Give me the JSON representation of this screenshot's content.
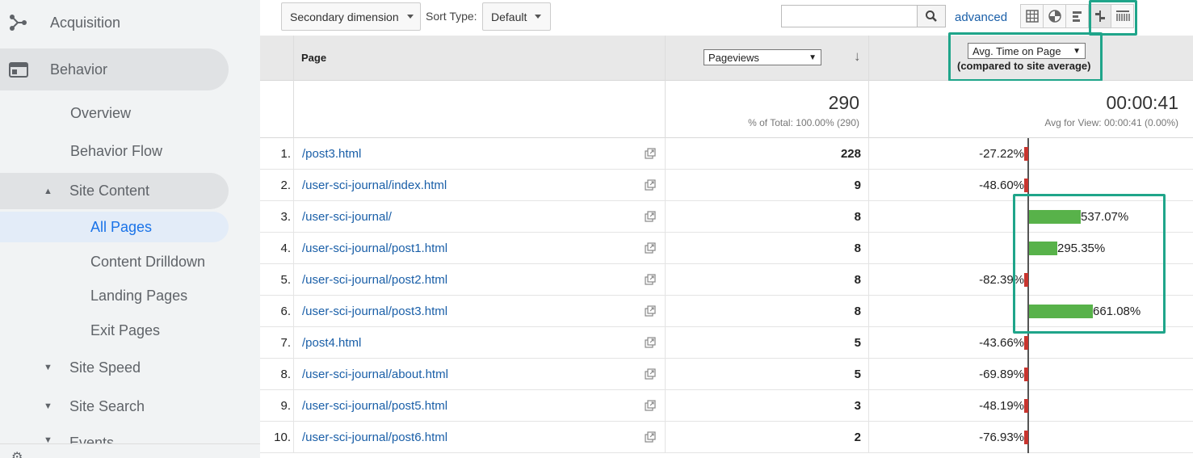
{
  "sidebar": {
    "acquisition": "Acquisition",
    "behavior": "Behavior",
    "overview": "Overview",
    "behavior_flow": "Behavior Flow",
    "site_content": "Site Content",
    "all_pages": "All Pages",
    "content_drilldown": "Content Drilldown",
    "landing_pages": "Landing Pages",
    "exit_pages": "Exit Pages",
    "site_speed": "Site Speed",
    "site_search": "Site Search",
    "events": "Events"
  },
  "toolbar": {
    "secondary_dimension": "Secondary dimension",
    "sort_type_label": "Sort Type:",
    "sort_type_value": "Default",
    "search_placeholder": "",
    "advanced": "advanced"
  },
  "table": {
    "page_header": "Page",
    "metric_select": "Pageviews",
    "compare_select": "Avg. Time on Page",
    "compare_sub": "(compared to site average)",
    "summary": {
      "pageviews": "290",
      "pageviews_sub": "% of Total: 100.00% (290)",
      "avg_time": "00:00:41",
      "avg_time_sub": "Avg for View: 00:00:41 (0.00%)"
    },
    "rows": [
      {
        "idx": "1.",
        "page": "/post3.html",
        "pv": "228",
        "pct": "-27.22%",
        "val": -27.22
      },
      {
        "idx": "2.",
        "page": "/user-sci-journal/index.html",
        "pv": "9",
        "pct": "-48.60%",
        "val": -48.6
      },
      {
        "idx": "3.",
        "page": "/user-sci-journal/",
        "pv": "8",
        "pct": "537.07%",
        "val": 537.07
      },
      {
        "idx": "4.",
        "page": "/user-sci-journal/post1.html",
        "pv": "8",
        "pct": "295.35%",
        "val": 295.35
      },
      {
        "idx": "5.",
        "page": "/user-sci-journal/post2.html",
        "pv": "8",
        "pct": "-82.39%",
        "val": -82.39
      },
      {
        "idx": "6.",
        "page": "/user-sci-journal/post3.html",
        "pv": "8",
        "pct": "661.08%",
        "val": 661.08
      },
      {
        "idx": "7.",
        "page": "/post4.html",
        "pv": "5",
        "pct": "-43.66%",
        "val": -43.66
      },
      {
        "idx": "8.",
        "page": "/user-sci-journal/about.html",
        "pv": "5",
        "pct": "-69.89%",
        "val": -69.89
      },
      {
        "idx": "9.",
        "page": "/user-sci-journal/post5.html",
        "pv": "3",
        "pct": "-48.19%",
        "val": -48.19
      },
      {
        "idx": "10.",
        "page": "/user-sci-journal/post6.html",
        "pv": "2",
        "pct": "-76.93%",
        "val": -76.93
      }
    ]
  },
  "colors": {
    "positive_bar": "#58b24a",
    "negative_bar": "#c8352f",
    "highlight": "#1fa58a",
    "link": "#1a5fa8"
  }
}
